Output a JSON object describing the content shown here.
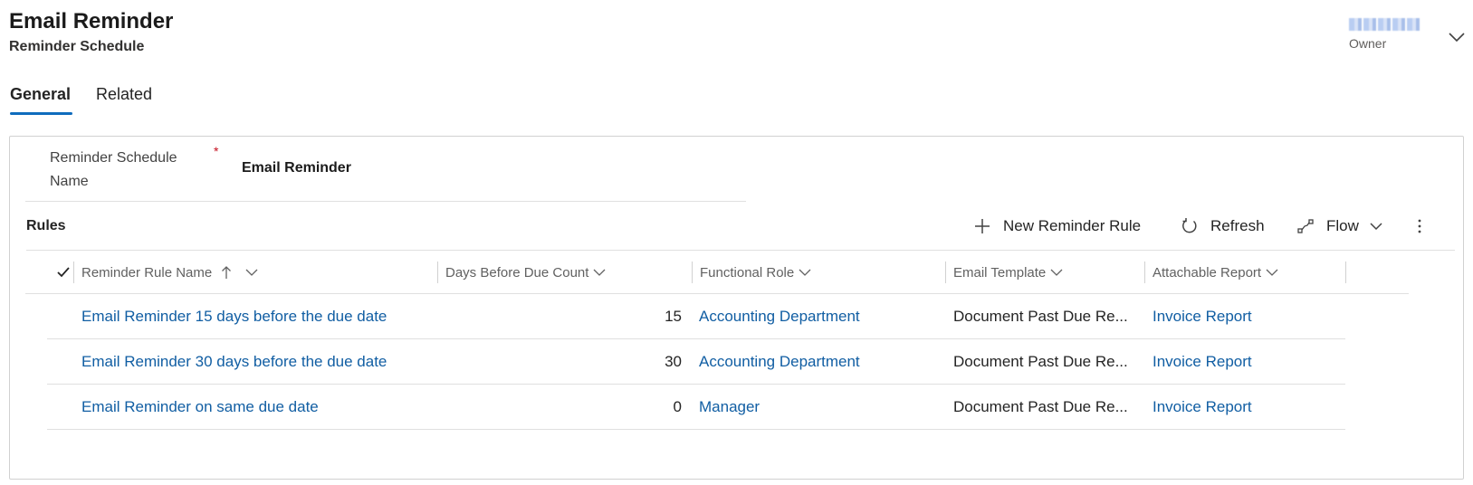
{
  "header": {
    "title": "Email Reminder",
    "subtitle": "Reminder Schedule",
    "owner_label": "Owner"
  },
  "tabs": [
    {
      "label": "General",
      "selected": true
    },
    {
      "label": "Related",
      "selected": false
    }
  ],
  "form": {
    "name_label": "Reminder Schedule Name",
    "required_marker": "*",
    "name_value": "Email Reminder"
  },
  "rules": {
    "title": "Rules",
    "commands": {
      "new_label": "New Reminder Rule",
      "refresh_label": "Refresh",
      "flow_label": "Flow"
    },
    "columns": [
      {
        "label": "Reminder Rule Name",
        "sorted": "ascending"
      },
      {
        "label": "Days Before Due Count"
      },
      {
        "label": "Functional Role"
      },
      {
        "label": "Email Template"
      },
      {
        "label": "Attachable Report"
      }
    ],
    "rows": [
      {
        "name": "Email Reminder 15 days before the due date",
        "days": "15",
        "role": "Accounting Department",
        "template": "Document Past Due Re...",
        "report": "Invoice Report"
      },
      {
        "name": "Email Reminder 30 days before the due date",
        "days": "30",
        "role": "Accounting Department",
        "template": "Document Past Due Re...",
        "report": "Invoice Report"
      },
      {
        "name": "Email Reminder on same due date",
        "days": "0",
        "role": "Manager",
        "template": "Document Past Due Re...",
        "report": "Invoice Report"
      }
    ]
  },
  "colors": {
    "accent": "#0f6cbd",
    "link": "#115ea3",
    "required": "#c50f1f"
  },
  "icons": [
    "chevron-down-icon",
    "add-icon",
    "refresh-icon",
    "flow-icon",
    "more-vertical-icon",
    "checkmark-icon",
    "sort-ascending-icon"
  ]
}
